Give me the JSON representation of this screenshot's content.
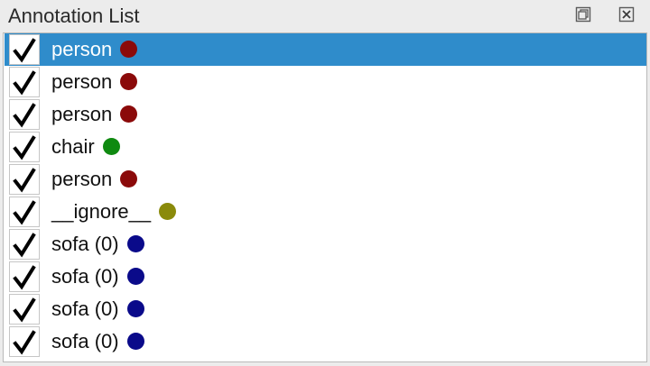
{
  "panel": {
    "title": "Annotation List",
    "float_icon": "float-window-icon",
    "close_icon": "close-icon"
  },
  "annotations": [
    {
      "label": "person",
      "checked": true,
      "color": "#8b0a0a",
      "selected": true
    },
    {
      "label": "person",
      "checked": true,
      "color": "#8b0a0a",
      "selected": false
    },
    {
      "label": "person",
      "checked": true,
      "color": "#8b0a0a",
      "selected": false
    },
    {
      "label": "chair",
      "checked": true,
      "color": "#0f8a10",
      "selected": false
    },
    {
      "label": "person",
      "checked": true,
      "color": "#8b0a0a",
      "selected": false
    },
    {
      "label": "__ignore__",
      "checked": true,
      "color": "#8a8a0a",
      "selected": false
    },
    {
      "label": "sofa (0)",
      "checked": true,
      "color": "#0a0a8a",
      "selected": false
    },
    {
      "label": "sofa (0)",
      "checked": true,
      "color": "#0a0a8a",
      "selected": false
    },
    {
      "label": "sofa (0)",
      "checked": true,
      "color": "#0a0a8a",
      "selected": false
    },
    {
      "label": "sofa (0)",
      "checked": true,
      "color": "#0a0a8a",
      "selected": false
    }
  ],
  "colors": {
    "selection": "#2f8ccb",
    "panel_bg": "#ececec",
    "list_bg": "#ffffff"
  }
}
